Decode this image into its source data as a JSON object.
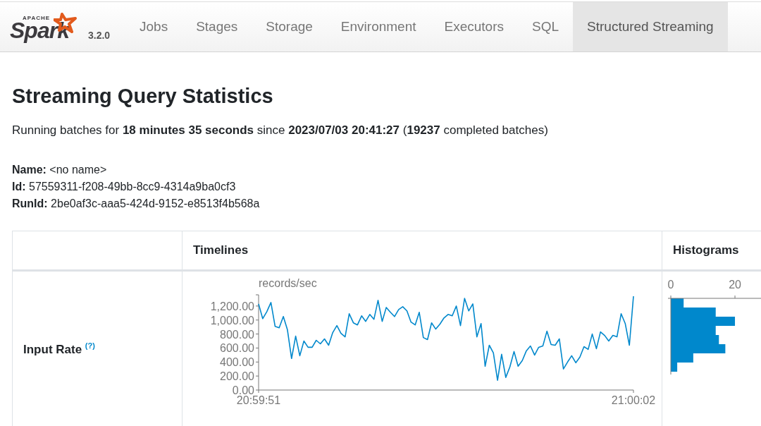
{
  "navbar": {
    "logo": {
      "top": "APACHE",
      "word": "Spark"
    },
    "version": "3.2.0",
    "tabs": [
      {
        "label": "Jobs",
        "selected": false
      },
      {
        "label": "Stages",
        "selected": false
      },
      {
        "label": "Storage",
        "selected": false
      },
      {
        "label": "Environment",
        "selected": false
      },
      {
        "label": "Executors",
        "selected": false
      },
      {
        "label": "SQL",
        "selected": false
      },
      {
        "label": "Structured Streaming",
        "selected": true
      }
    ]
  },
  "title": "Streaming Query Statistics",
  "summary": "Running batches for **18 minutes 35 seconds** since **2023/07/03 20:41:27** (**19237** completed batches)",
  "details": [
    {
      "label": "Name:",
      "value": "<no name>"
    },
    {
      "label": "Id:",
      "value": "57559311-f208-49bb-8cc9-4314a9ba0cf3"
    },
    {
      "label": "RunId:",
      "value": "2be0af3c-aaa5-424d-9152-e8513f4b568a"
    }
  ],
  "table": {
    "columns": [
      "Timelines",
      "Histograms"
    ],
    "rows": [
      {
        "label": "Input Rate",
        "help": "(?)",
        "timeline": {
          "chart_data": {
            "type": "line",
            "ylabel": "records/sec",
            "ylim": [
              0,
              1360
            ],
            "categories": [
              "20:59:51",
              null,
              null,
              null,
              null,
              null,
              null,
              null,
              null,
              null,
              null,
              null,
              null,
              null,
              null,
              null,
              null,
              null,
              null,
              null,
              null,
              null,
              null,
              null,
              null,
              null,
              null,
              null,
              null,
              null,
              null,
              null,
              null,
              null,
              null,
              null,
              null,
              null,
              null,
              null,
              null,
              null,
              null,
              null,
              null,
              null,
              null,
              null,
              null,
              null,
              null,
              null,
              null,
              null,
              null,
              null,
              null,
              null,
              null,
              null,
              null,
              null,
              null,
              null,
              null,
              null,
              null,
              null,
              null,
              null,
              null,
              null,
              null,
              null,
              null,
              null,
              null,
              null,
              null,
              null,
              null,
              null,
              null,
              null,
              null,
              null,
              null,
              null,
              null,
              null,
              null,
              "21:00:02"
            ],
            "yticks": [
              {
                "value": 0,
                "label": "0.00"
              },
              {
                "value": 200,
                "label": "200.00"
              },
              {
                "value": 400,
                "label": "400.00"
              },
              {
                "value": 600,
                "label": "600.00"
              },
              {
                "value": 800,
                "label": "800.00"
              },
              {
                "value": 1000,
                "label": "1,000.00"
              },
              {
                "value": 1200,
                "label": "1,200.00"
              }
            ],
            "series": [
              {
                "color": "#0088cc",
                "values": [
                  1230,
                  1020,
                  1120,
                  1250,
                  910,
                  890,
                  1050,
                  860,
                  450,
                  770,
                  490,
                  700,
                  610,
                  610,
                  710,
                  660,
                  730,
                  640,
                  820,
                  920,
                  810,
                  760,
                  1090,
                  960,
                  930,
                  1060,
                  980,
                  1080,
                  1010,
                  1280,
                  980,
                  1180,
                  1110,
                  1050,
                  1150,
                  1190,
                  1130,
                  970,
                  930,
                  1110,
                  750,
                  720,
                  960,
                  870,
                  940,
                  1030,
                  1080,
                  1060,
                  1200,
                  920,
                  1310,
                  1130,
                  1230,
                  760,
                  950,
                  340,
                  640,
                  530,
                  140,
                  510,
                  180,
                  330,
                  550,
                  340,
                  420,
                  560,
                  630,
                  500,
                  610,
                  630,
                  840,
                  650,
                  640,
                  730,
                  300,
                  400,
                  490,
                  390,
                  470,
                  620,
                  580,
                  800,
                  590,
                  830,
                  780,
                  700,
                  780,
                  760,
                  1090,
                  950,
                  640,
                  1340
                ]
              }
            ]
          }
        },
        "histogram": {
          "chart_data": {
            "type": "bar",
            "orientation": "horizontal",
            "xlim": [
              0,
              29
            ],
            "xticks": [
              0,
              20
            ],
            "series": [
              {
                "color": "#0088cc",
                "values": [
                  4,
                  14,
                  20,
                  14,
                  15,
                  17,
                  7,
                  2
                ]
              }
            ]
          }
        }
      }
    ]
  }
}
